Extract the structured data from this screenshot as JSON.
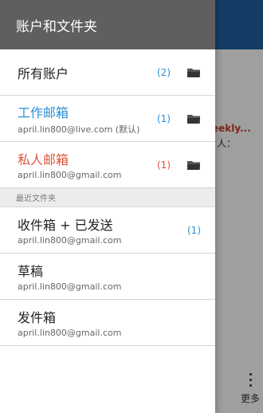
{
  "background": {
    "snippet_title": "eekly...",
    "snippet_sub": "人：",
    "more_label": "更多"
  },
  "drawer": {
    "title": "账户和文件夹",
    "accounts": [
      {
        "name": "所有账户",
        "count": "(2)",
        "name_color": "#222222",
        "count_color": "#2a8fd6",
        "icon": "folder-icon"
      },
      {
        "name": "工作邮箱",
        "email": "april.lin800@live.com (默认)",
        "count": "(1)",
        "name_color": "#2a8fd6",
        "count_color": "#2a8fd6",
        "icon": "folder-icon"
      },
      {
        "name": "私人邮箱",
        "email": "april.lin800@gmail.com",
        "count": "(1)",
        "name_color": "#e0533a",
        "count_color": "#e0533a",
        "icon": "folder-icon"
      }
    ],
    "recent_section_label": "最近文件夹",
    "recent_folders": [
      {
        "name": "收件箱 + 已发送",
        "email": "april.lin800@gmail.com",
        "count": "(1)",
        "count_color": "#2a8fd6"
      },
      {
        "name": "草稿",
        "email": "april.lin800@gmail.com"
      },
      {
        "name": "发件箱",
        "email": "april.lin800@gmail.com"
      }
    ]
  }
}
